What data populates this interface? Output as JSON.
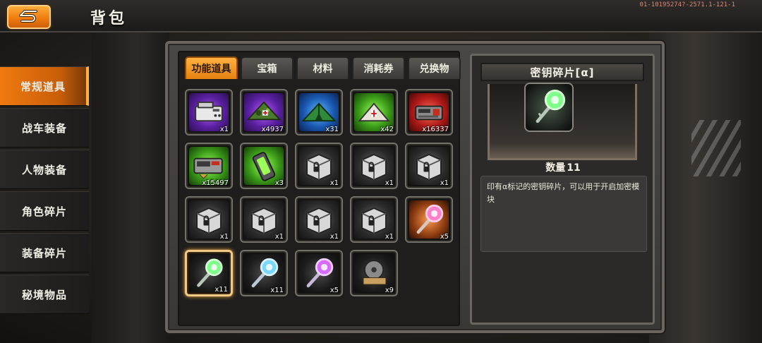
{
  "header": {
    "title": "背包",
    "version": "01-10195274?-2571.1-121-1"
  },
  "sidebar": {
    "items": [
      {
        "label": "常规道具",
        "active": true
      },
      {
        "label": "战车装备",
        "active": false
      },
      {
        "label": "人物装备",
        "active": false
      },
      {
        "label": "角色碎片",
        "active": false
      },
      {
        "label": "装备碎片",
        "active": false
      },
      {
        "label": "秘境物品",
        "active": false
      }
    ]
  },
  "tabs": [
    {
      "label": "功能道具",
      "active": true
    },
    {
      "label": "宝箱",
      "active": false
    },
    {
      "label": "材料",
      "active": false
    },
    {
      "label": "消耗券",
      "active": false
    },
    {
      "label": "兑换物",
      "active": false
    }
  ],
  "inventory": [
    {
      "icon": "fax-machine-icon",
      "bg": "purple",
      "qty": "x1"
    },
    {
      "icon": "camo-tent-icon",
      "bg": "purple",
      "qty": "x4937"
    },
    {
      "icon": "medic-tent-icon",
      "bg": "blue",
      "qty": "x31"
    },
    {
      "icon": "first-aid-tent-icon",
      "bg": "green",
      "qty": "x42"
    },
    {
      "icon": "machine-part-icon",
      "bg": "red",
      "qty": "x16337"
    },
    {
      "icon": "armor-machine-icon",
      "bg": "green",
      "qty": "x15497"
    },
    {
      "icon": "battery-canister-icon",
      "bg": "green",
      "qty": "x3"
    },
    {
      "icon": "locked-crate-icon",
      "bg": "gray",
      "qty": "x1"
    },
    {
      "icon": "locked-crate-icon",
      "bg": "gray",
      "qty": "x1"
    },
    {
      "icon": "locked-crate-icon",
      "bg": "gray",
      "qty": "x1"
    },
    {
      "icon": "locked-crate-icon",
      "bg": "gray",
      "qty": "x1"
    },
    {
      "icon": "locked-crate-icon",
      "bg": "gray",
      "qty": "x1"
    },
    {
      "icon": "locked-crate-icon",
      "bg": "gray",
      "qty": "x1"
    },
    {
      "icon": "locked-crate-icon",
      "bg": "gray",
      "qty": "x1"
    },
    {
      "icon": "orange-key-icon",
      "bg": "orange",
      "qty": "x5"
    },
    {
      "icon": "green-key-icon",
      "bg": "dark",
      "qty": "x11",
      "selected": true
    },
    {
      "icon": "blue-key-icon",
      "bg": "dark",
      "qty": "x11"
    },
    {
      "icon": "purple-key-icon",
      "bg": "dark",
      "qty": "x5"
    },
    {
      "icon": "film-reel-icon",
      "bg": "dark",
      "qty": "x9"
    }
  ],
  "detail": {
    "name": "密钥碎片[α]",
    "qty_label": "数量",
    "qty_value": "11",
    "description": "印有α标记的密钥碎片，可以用于开启加密模块"
  },
  "colors": {
    "accent": "#f07c10",
    "selected_border": "#f3c98a",
    "key_green": "#7dff8a"
  }
}
